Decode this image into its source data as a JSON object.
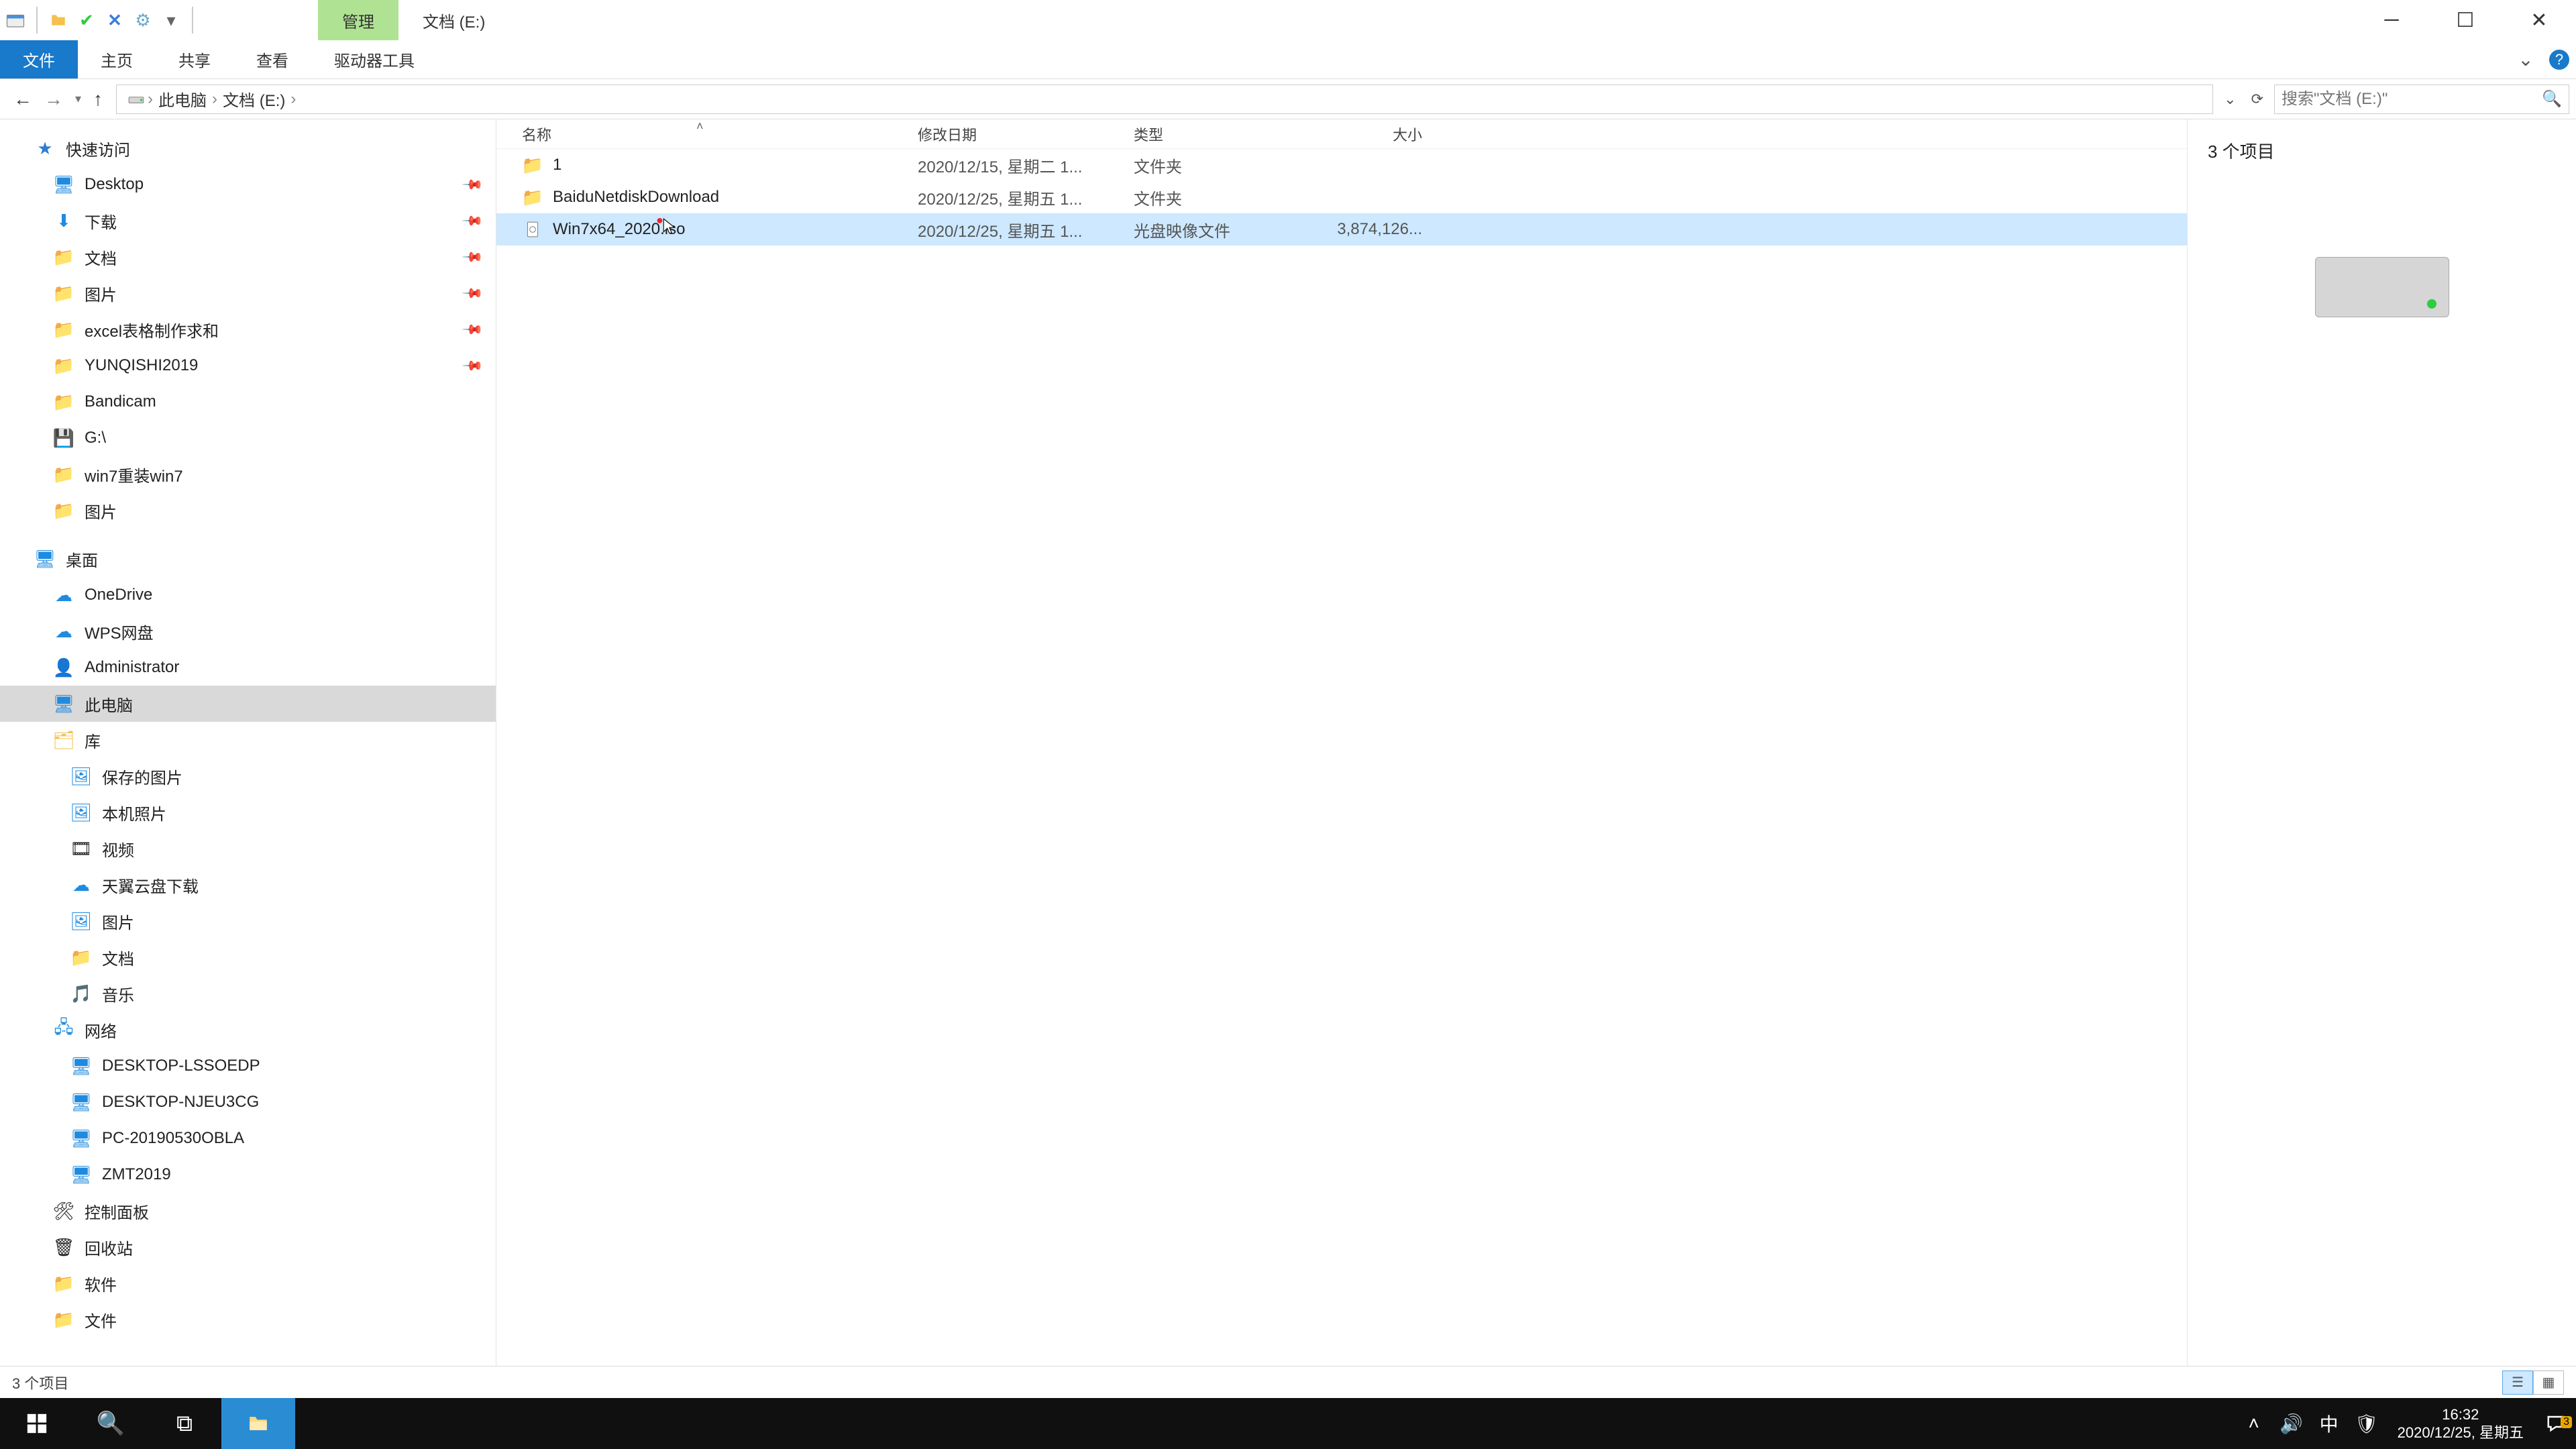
{
  "titlebar": {
    "context_tab": "管理",
    "title_tab": "文档 (E:)"
  },
  "ribbon": {
    "file": "文件",
    "home": "主页",
    "share": "共享",
    "view": "查看",
    "drive_tools": "驱动器工具"
  },
  "address": {
    "crumb1": "此电脑",
    "crumb2": "文档 (E:)"
  },
  "search": {
    "placeholder": "搜索\"文档 (E:)\""
  },
  "tree": {
    "quick_access": "快速访问",
    "desktop": "Desktop",
    "downloads": "下载",
    "documents": "文档",
    "pictures": "图片",
    "excel": "excel表格制作求和",
    "yunqishi": "YUNQISHI2019",
    "bandicam": "Bandicam",
    "gdrive": "G:\\",
    "win7reinstall": "win7重装win7",
    "pictures2": "图片",
    "desktop_root": "桌面",
    "onedrive": "OneDrive",
    "wps": "WPS网盘",
    "admin": "Administrator",
    "thispc": "此电脑",
    "lib": "库",
    "saved_pics": "保存的图片",
    "camera_roll": "本机照片",
    "video": "视频",
    "tianyi": "天翼云盘下载",
    "pictures3": "图片",
    "documents2": "文档",
    "music": "音乐",
    "network": "网络",
    "net1": "DESKTOP-LSSOEDP",
    "net2": "DESKTOP-NJEU3CG",
    "net3": "PC-20190530OBLA",
    "net4": "ZMT2019",
    "ctrlpanel": "控制面板",
    "recycle": "回收站",
    "soft": "软件",
    "files": "文件"
  },
  "columns": {
    "name": "名称",
    "date": "修改日期",
    "type": "类型",
    "size": "大小"
  },
  "files": [
    {
      "name": "1",
      "date": "2020/12/15, 星期二 1...",
      "type": "文件夹",
      "size": "",
      "kind": "folder"
    },
    {
      "name": "BaiduNetdiskDownload",
      "date": "2020/12/25, 星期五 1...",
      "type": "文件夹",
      "size": "",
      "kind": "folder"
    },
    {
      "name": "Win7x64_2020.iso",
      "date": "2020/12/25, 星期五 1...",
      "type": "光盘映像文件",
      "size": "3,874,126...",
      "kind": "iso"
    }
  ],
  "preview": {
    "count_label": "3 个项目"
  },
  "status": {
    "count_label": "3 个项目"
  },
  "tray": {
    "ime": "中",
    "time": "16:32",
    "date": "2020/12/25, 星期五",
    "notif_badge": "3"
  }
}
